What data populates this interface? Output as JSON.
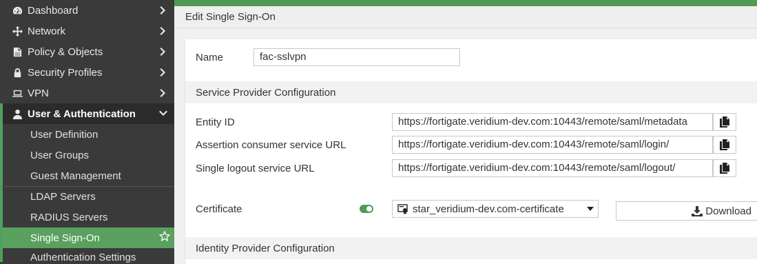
{
  "sidebar": {
    "items": [
      {
        "label": "Dashboard",
        "icon": "dashboard-icon"
      },
      {
        "label": "Network",
        "icon": "network-icon"
      },
      {
        "label": "Policy & Objects",
        "icon": "policy-icon"
      },
      {
        "label": "Security Profiles",
        "icon": "lock-icon"
      },
      {
        "label": "VPN",
        "icon": "vpn-icon"
      },
      {
        "label": "User & Authentication",
        "icon": "user-icon"
      }
    ],
    "sub_items": [
      {
        "label": "User Definition"
      },
      {
        "label": "User Groups"
      },
      {
        "label": "Guest Management"
      },
      {
        "label": "LDAP Servers"
      },
      {
        "label": "RADIUS Servers"
      },
      {
        "label": "Single Sign-On"
      },
      {
        "label": "Authentication Settings"
      }
    ]
  },
  "header": {
    "title": "Edit Single Sign-On"
  },
  "form": {
    "name_label": "Name",
    "name_value": "fac-sslvpn",
    "sp_section": "Service Provider Configuration",
    "entity_label": "Entity ID",
    "entity_value": "https://fortigate.veridium-dev.com:10443/remote/saml/metadata",
    "acs_label": "Assertion consumer service URL",
    "acs_value": "https://fortigate.veridium-dev.com:10443/remote/saml/login/",
    "slo_label": "Single logout service URL",
    "slo_value": "https://fortigate.veridium-dev.com:10443/remote/saml/logout/",
    "cert_label": "Certificate",
    "cert_enabled": true,
    "cert_value": "star_veridium-dev.com-certificate",
    "download_label": "Download",
    "idp_section": "Identity Provider Configuration"
  },
  "colors": {
    "accent": "#4f9a55",
    "sidebar_bg": "#3a3a3a",
    "selected": "#5aa05e"
  }
}
